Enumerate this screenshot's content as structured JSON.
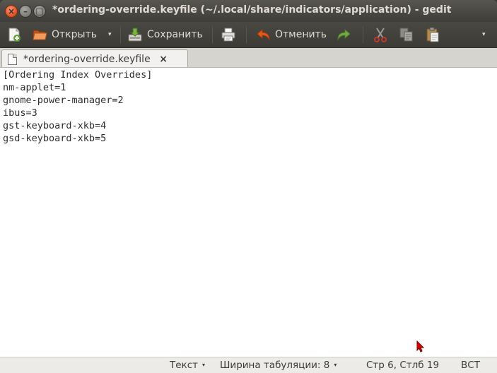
{
  "window": {
    "title": "*ordering-override.keyfile (~/.local/share/indicators/application) - gedit",
    "close_glyph": "×",
    "minimize_glyph": "–",
    "maximize_glyph": "□"
  },
  "toolbar": {
    "new_icon": "document-new-icon",
    "open_label": "Открыть",
    "save_label": "Сохранить",
    "undo_label": "Отменить",
    "overflow_glyph": "▾",
    "dropdown_glyph": "▾"
  },
  "tab": {
    "label": "*ordering-override.keyfile",
    "close_glyph": "×"
  },
  "editor": {
    "lines": [
      "[Ordering Index Overrides]",
      "nm-applet=1",
      "gnome-power-manager=2",
      "ibus=3",
      "gst-keyboard-xkb=4",
      "gsd-keyboard-xkb=5"
    ]
  },
  "statusbar": {
    "language": "Текст",
    "tab_width": "Ширина табуляции: 8",
    "position": "Стр 6, Стлб 19",
    "mode": "ВСТ",
    "dropdown_glyph": "▾"
  },
  "colors": {
    "titlebar": "#3c3b37",
    "close_button": "#e4572b",
    "redo_arrow": "#73a946",
    "undo_arrow": "#e25b1a"
  }
}
